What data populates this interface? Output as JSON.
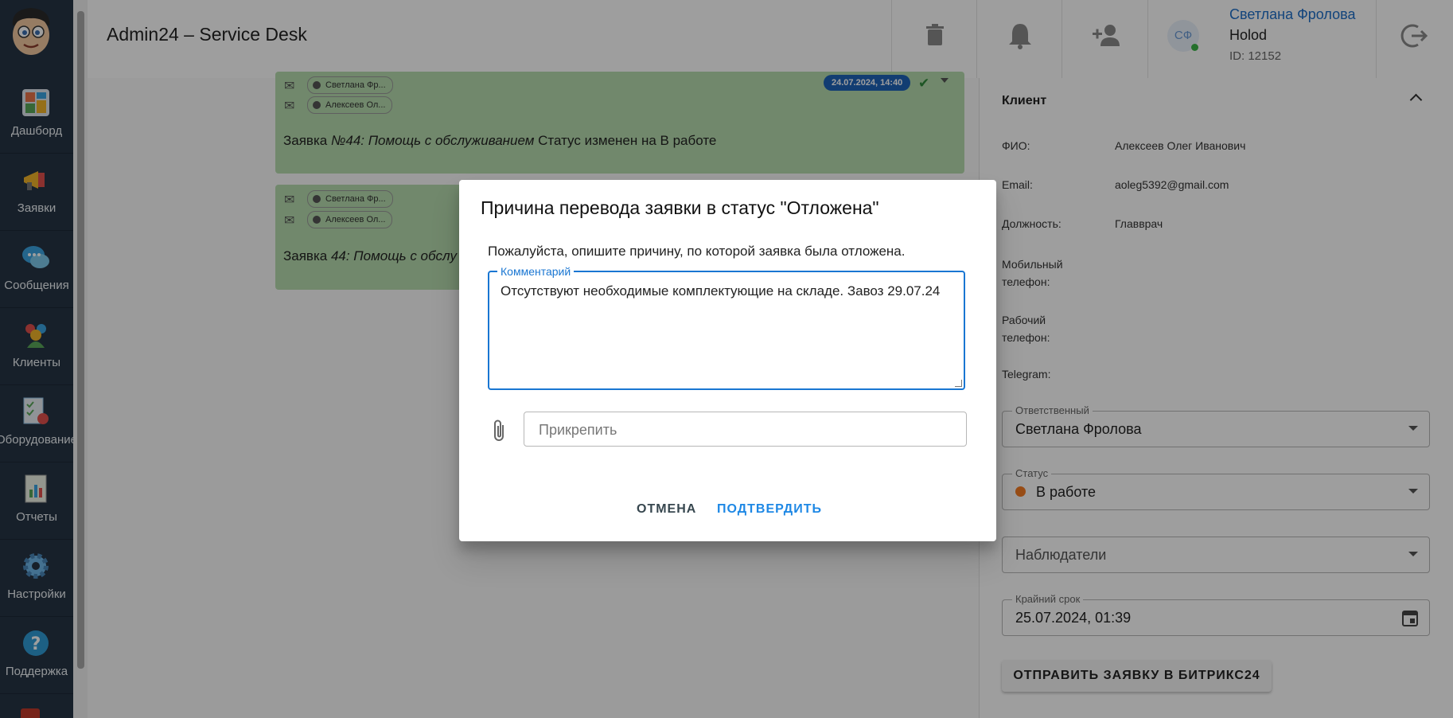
{
  "app": {
    "title": "Admin24 – Service Desk"
  },
  "header": {
    "user_name": "Светлана Фролова",
    "user_initials": "СФ",
    "company": "Holod",
    "user_id": "ID: 12152"
  },
  "sidebar": {
    "items": [
      {
        "label": "Дашборд",
        "icon": "dashboard-icon",
        "color": "#e8734a"
      },
      {
        "label": "Заявки",
        "icon": "megaphone-icon",
        "color": "#f0b429"
      },
      {
        "label": "Сообщения",
        "icon": "chat-bubbles-icon",
        "color": "#3aa4e0"
      },
      {
        "label": "Клиенты",
        "icon": "clients-icon",
        "color": "#e0504d"
      },
      {
        "label": "Оборудование",
        "icon": "checklist-icon",
        "color": "#8fc3e8"
      },
      {
        "label": "Отчеты",
        "icon": "report-icon",
        "color": "#5aa65a"
      },
      {
        "label": "Настройки",
        "icon": "gear-icon",
        "color": "#6fb6e8"
      },
      {
        "label": "Поддержка",
        "icon": "help-icon",
        "color": "#2f9cd6"
      }
    ]
  },
  "messages": [
    {
      "from": "Светлана Фр...",
      "to": "Алексеев Ол...",
      "date": "24.07.2024, 14:40",
      "text_prefix": "Заявка ",
      "text_italic": "№44: Помощь с обслуживанием",
      "text_suffix": " Статус изменен на В работе"
    },
    {
      "from": "Светлана Фр...",
      "to": "Алексеев Ол...",
      "text_prefix": "Заявка ",
      "text_italic": "44: Помощь с обслу"
    }
  ],
  "client_panel": {
    "section_title": "Клиент",
    "fields": [
      {
        "label": "ФИО:",
        "value": "Алексеев Олег Иванович"
      },
      {
        "label": "Email:",
        "value": "aoleg5392@gmail.com"
      },
      {
        "label": "Должность:",
        "value": "Главврач"
      },
      {
        "label": "Мобильный телефон:",
        "value": ""
      },
      {
        "label": "Рабочий телефон:",
        "value": ""
      },
      {
        "label": "Telegram:",
        "value": ""
      }
    ],
    "responsible_label": "Ответственный",
    "responsible_value": "Светлана Фролова",
    "status_label": "Статус",
    "status_value": "В работе",
    "status_color": "#f57c24",
    "observers_placeholder": "Наблюдатели",
    "deadline_label": "Крайний срок",
    "deadline_value": "25.07.2024, 01:39",
    "bitrix_button": "ОТПРАВИТЬ ЗАЯВКУ В БИТРИКС24"
  },
  "dialog": {
    "title": "Причина перевода заявки в статус \"Отложена\"",
    "description": "Пожалуйста, опишите причину, по которой заявка была отложена.",
    "comment_label": "Комментарий",
    "comment_value": "Отсутствуют необходимые комплектующие на складе. Завоз 29.07.24",
    "attach_placeholder": "Прикрепить",
    "cancel_label": "ОТМЕНА",
    "confirm_label": "ПОДТВЕРДИТЬ"
  },
  "colors": {
    "accent": "#1976d2",
    "sidebar": "#263445",
    "message_bg": "#b6dcae",
    "date_badge": "#1e63b8"
  }
}
